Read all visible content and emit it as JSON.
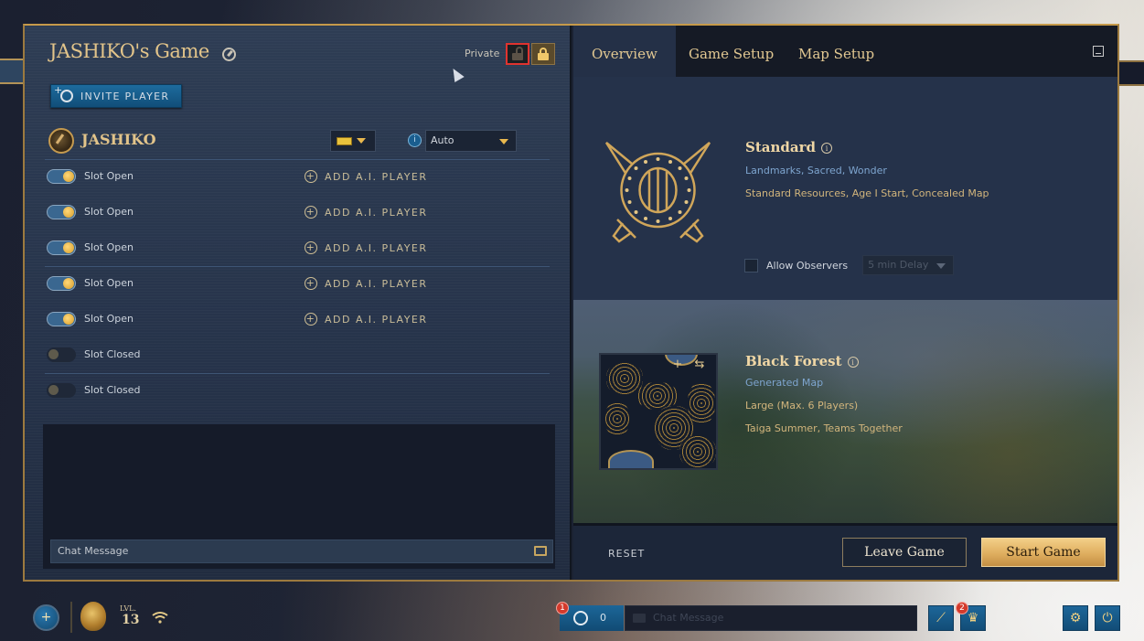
{
  "lobby": {
    "title": "JASHIKO's Game",
    "privacy_label": "Private",
    "invite_label": "INVITE PLAYER",
    "host": {
      "name": "JASHIKO",
      "color": "#e8c23c",
      "team": "Auto"
    },
    "slots": [
      {
        "label": "Slot Open",
        "open": true,
        "action": "ADD A.I. PLAYER"
      },
      {
        "label": "Slot Open",
        "open": true,
        "action": "ADD A.I. PLAYER"
      },
      {
        "label": "Slot Open",
        "open": true,
        "action": "ADD A.I. PLAYER"
      },
      {
        "label": "Slot Open",
        "open": true,
        "action": "ADD A.I. PLAYER"
      },
      {
        "label": "Slot Open",
        "open": true,
        "action": "ADD A.I. PLAYER"
      },
      {
        "label": "Slot Closed",
        "open": false,
        "action": ""
      },
      {
        "label": "Slot Closed",
        "open": false,
        "action": ""
      }
    ],
    "chat_placeholder": "Chat Message"
  },
  "setup": {
    "tabs": [
      {
        "label": "Overview",
        "active": true
      },
      {
        "label": "Game Setup",
        "active": false
      },
      {
        "label": "Map Setup",
        "active": false
      }
    ],
    "mode": {
      "title": "Standard",
      "victory": "Landmarks, Sacred, Wonder",
      "details": "Standard Resources, Age I Start, Concealed Map",
      "allow_observers_label": "Allow Observers",
      "allow_observers_checked": false,
      "delay": "5 min Delay"
    },
    "map": {
      "title": "Black Forest",
      "type": "Generated Map",
      "size": "Large (Max. 6 Players)",
      "biome": "Taiga Summer, Teams Together",
      "zoom_in_label": "+",
      "swap_label": "⇆"
    },
    "footer": {
      "reset_label": "RESET",
      "leave_label": "Leave Game",
      "start_label": "Start Game"
    }
  },
  "bottom_bar": {
    "level_label": "LVL.",
    "level": "13",
    "plus_label": "+",
    "social_badge": "1",
    "social_count": "0",
    "chat_placeholder": "Chat Message",
    "notifications_badge": "2"
  }
}
